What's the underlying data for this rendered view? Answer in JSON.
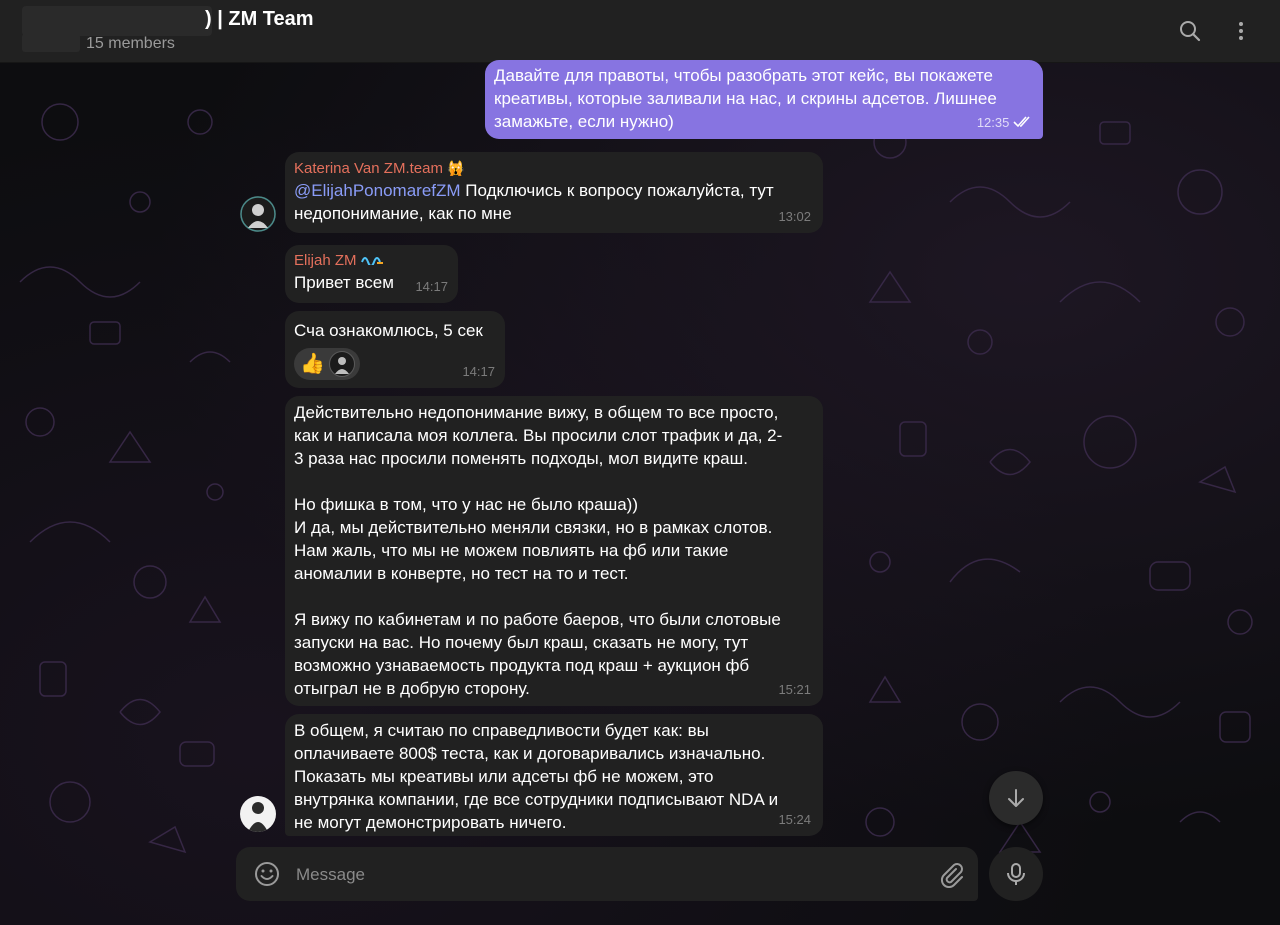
{
  "header": {
    "title": ") | ZM Team",
    "members": "15 members"
  },
  "messages": [
    {
      "direction": "out",
      "text": "Давайте для правоты, чтобы разобрать этот кейс, вы покажете\nкреативы, которые заливали на нас, и скрины адсетов. Лишнее\nзамажьте, если нужно)",
      "time": "12:35",
      "status": "double-check-icon"
    },
    {
      "sender": "Katerina Van ZM.team",
      "sender_color": "#e4705c",
      "sender_badge": "🙀",
      "mention": "@ElijahPonomarefZM",
      "text": " Подключись к вопросу пожалуйста, тут\nнедопонимание, как по мне",
      "time": "13:02"
    },
    {
      "sender": "Elijah ZM",
      "sender_color": "#e4705c",
      "text": "Привет всем",
      "time": "14:17"
    },
    {
      "text": "Сча ознакомлюсь, 5 сек",
      "reaction_emoji": "👍",
      "time": "14:17"
    },
    {
      "text": "Действительно недопонимание вижу, в общем то все просто,\nкак и написала моя коллега. Вы просили слот трафик и да, 2-\n3 раза нас просили поменять подходы, мол видите краш.\n\nНо фишка в том, что у нас не было краша))\nИ да, мы действительно меняли связки, но в рамках слотов.\nНам жаль, что мы не можем повлиять на фб или такие\nаномалии в конверте, но тест на то и тест.\n\nЯ вижу по кабинетам и по работе баеров, что были слотовые\nзапуски на вас. Но почему был краш, сказать не могу, тут\nвозможно узнаваемость продукта под краш + аукцион фб\nотыграл не в добрую сторону.",
      "time": "15:21"
    },
    {
      "text": "В общем, я считаю по справедливости будет как: вы\nоплачиваете 800$ теста, как и договаривались изначально.\nПоказать мы креативы или адсеты фб не можем, это\nвнутрянка компании, где все сотрудники подписывают NDA и\nне могут демонстрировать ничего.",
      "time": "15:24"
    }
  ],
  "composer": {
    "placeholder": "Message"
  },
  "colors": {
    "accent_outgoing": "#8774e1",
    "bubble_incoming": "#212121",
    "header_bg": "#212121",
    "mention": "#8a9cf7",
    "sender_name": "#e4705c"
  },
  "icons": [
    "search-icon",
    "more-vertical-icon",
    "emoji-icon",
    "attach-icon",
    "mic-icon",
    "arrow-down-icon",
    "double-check-icon"
  ]
}
